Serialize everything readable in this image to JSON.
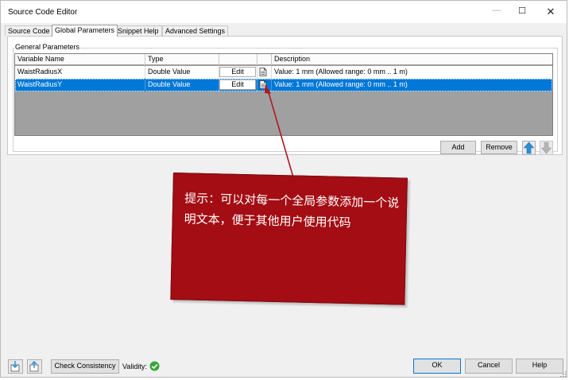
{
  "window": {
    "title": "Source Code Editor",
    "minimize_glyph": "—",
    "maximize_glyph": "☐",
    "close_glyph": "✕"
  },
  "tabs": [
    {
      "label": "Source Code",
      "active": false
    },
    {
      "label": "Global Parameters",
      "active": true
    },
    {
      "label": "Snippet Help",
      "active": false
    },
    {
      "label": "Advanced Settings",
      "active": false
    }
  ],
  "group": {
    "label": "General Parameters"
  },
  "table": {
    "columns": [
      "Variable Name",
      "Type",
      "",
      "",
      "Description"
    ],
    "rows": [
      {
        "name": "WaistRadiusX",
        "type": "Double Value",
        "edit_label": "Edit",
        "description": "Value: 1 mm (Allowed range: 0 mm .. 1 m)",
        "selected": false
      },
      {
        "name": "WaistRadiusY",
        "type": "Double Value",
        "edit_label": "Edit",
        "description": "Value: 1 mm (Allowed range: 0 mm .. 1 m)",
        "selected": true
      }
    ]
  },
  "actions": {
    "add_label": "Add",
    "remove_label": "Remove",
    "move_up_icon": "arrow-up-icon",
    "move_down_icon": "arrow-down-icon"
  },
  "callout": {
    "text": "提示：可以对每一个全局参数添加一个说明文本，便于其他用户使用代码"
  },
  "footer": {
    "check_label": "Check Consistency",
    "validity_label": "Validity:",
    "validity_icon": "check-circle-icon",
    "ok_label": "OK",
    "cancel_label": "Cancel",
    "help_label": "Help"
  },
  "colors": {
    "selection": "#0078d7",
    "callout": "#a30d13",
    "valid": "#3aa53a",
    "arrow_enabled": "#2a8fd8",
    "arrow_disabled": "#b5b5b5"
  }
}
